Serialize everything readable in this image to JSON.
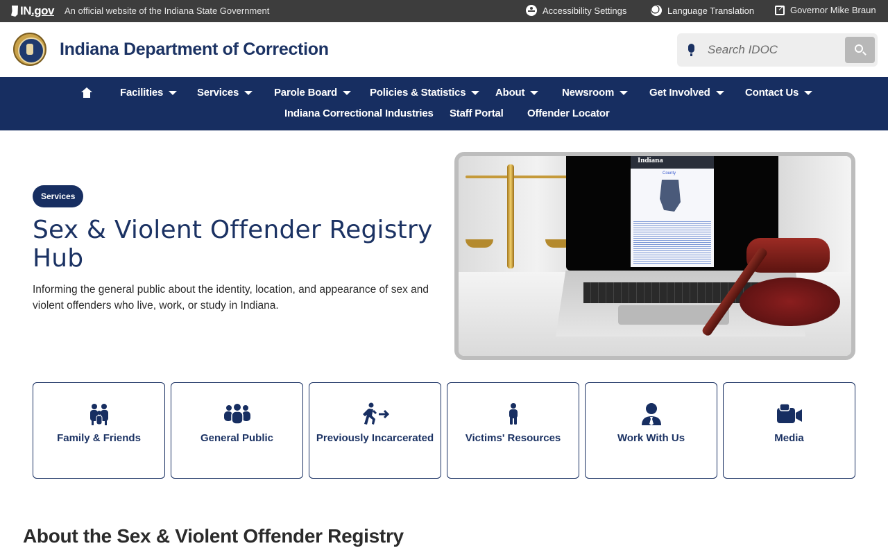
{
  "topbar": {
    "logo_text": "IN",
    "logo_suffix": ".gov",
    "official_text": "An official website of the Indiana State Government",
    "links": [
      {
        "label": "Accessibility Settings",
        "icon": "accessibility-icon"
      },
      {
        "label": "Language Translation",
        "icon": "globe-icon"
      },
      {
        "label": "Governor Mike Braun",
        "icon": "external-link-icon"
      }
    ]
  },
  "header": {
    "agency_name": "Indiana Department of Correction",
    "search_placeholder": "Search IDOC"
  },
  "nav": {
    "row1": [
      {
        "label": "Facilities",
        "dropdown": true
      },
      {
        "label": "Services",
        "dropdown": true
      },
      {
        "label": "Parole Board",
        "dropdown": true
      },
      {
        "label": "Policies & Statistics",
        "dropdown": true
      },
      {
        "label": "About",
        "dropdown": true
      },
      {
        "label": "Newsroom",
        "dropdown": true
      },
      {
        "label": "Get Involved",
        "dropdown": true
      },
      {
        "label": "Contact Us",
        "dropdown": true
      }
    ],
    "row2": [
      {
        "label": "Indiana Correctional Industries"
      },
      {
        "label": "Staff Portal"
      },
      {
        "label": "Offender Locator"
      }
    ]
  },
  "hero": {
    "badge": "Services",
    "title": "Sex & Violent Offender Registry Hub",
    "description": "Informing the general public about the identity, location, and appearance of sex and violent offenders who live, work, or study in Indiana.",
    "image_heading": "Indiana",
    "image_subheading": "County"
  },
  "cards": [
    {
      "label": "Family & Friends",
      "icon": "family-icon"
    },
    {
      "label": "General Public",
      "icon": "group-icon"
    },
    {
      "label": "Previously Incarcerated",
      "icon": "walking-person-arrow-icon"
    },
    {
      "label": "Victims' Resources",
      "icon": "person-icon"
    },
    {
      "label": "Work With Us",
      "icon": "user-tie-icon"
    },
    {
      "label": "Media",
      "icon": "video-camera-icon"
    }
  ],
  "section": {
    "title": "About the Sex & Violent Offender Registry"
  },
  "colors": {
    "navy": "#172e61",
    "topbar": "#3d3d3d",
    "title": "#1b3263"
  }
}
